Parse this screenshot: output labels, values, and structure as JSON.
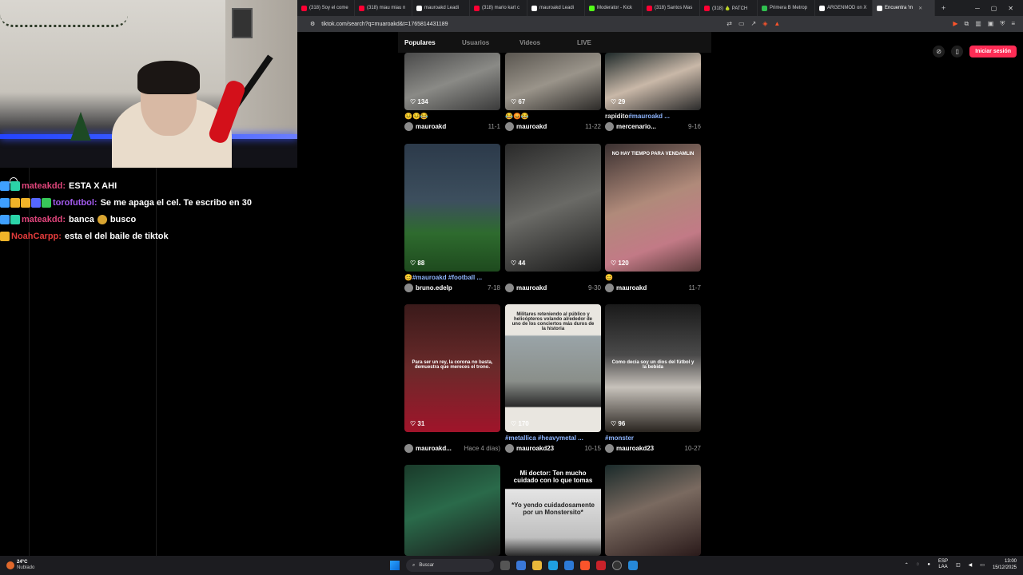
{
  "chat": {
    "messages": [
      {
        "user": "mateakdd:",
        "user_color": "#e0457b",
        "text": "ESTA X AHI",
        "badges": [
          "#3fa0ff",
          "#2bd4a8"
        ]
      },
      {
        "user": "torofutbol:",
        "user_color": "#a45bf0",
        "text": "Se me apaga el cel. Te escribo en 30",
        "badges": [
          "#3fa0ff",
          "#f0b429",
          "#f0b429",
          "#5667ff",
          "#38c95a"
        ]
      },
      {
        "user": "mateakdd:",
        "user_color": "#e0457b",
        "text_before": "banca",
        "text_after": "busco",
        "badges": [
          "#3fa0ff",
          "#2bd4a8"
        ]
      },
      {
        "user": "NoahCarpp:",
        "user_color": "#e23b3b",
        "text": "esta el del baile de tiktok",
        "badges": [
          "#f0b429"
        ]
      }
    ]
  },
  "browser": {
    "tabs": [
      {
        "label": "(318) Soy el come",
        "icon_color": "#ff0033"
      },
      {
        "label": "(318) miau miau n",
        "icon_color": "#ff0033"
      },
      {
        "label": "mauroakd Leadi",
        "icon_color": "#ffffff"
      },
      {
        "label": "(318) mario kart c",
        "icon_color": "#ff0033"
      },
      {
        "label": "mauroakd Leadi",
        "icon_color": "#ffffff"
      },
      {
        "label": "Moderator - Kick",
        "icon_color": "#53fc18"
      },
      {
        "label": "(318) Santos Mas",
        "icon_color": "#ff0033"
      },
      {
        "label": "(318) 🍐 PATCH",
        "icon_color": "#ff0033"
      },
      {
        "label": "Primera B Metrop",
        "icon_color": "#30c04f"
      },
      {
        "label": "ARGENMOD on X",
        "icon_color": "#ffffff"
      },
      {
        "label": "Encuentra 'm",
        "icon_color": "#ffffff",
        "active": true
      }
    ],
    "url": "tiktok.com/search?q=muaroakd&t=1765814431189"
  },
  "tiktok": {
    "search_tabs": [
      "Populares",
      "Usuarios",
      "Videos",
      "LIVE"
    ],
    "login_label": "Iniciar sesión",
    "videos": [
      {
        "likes": "134",
        "caption": "😣😣😂",
        "author": "mauroakd",
        "date": "11-1",
        "bg": "linear-gradient(160deg,#4a4a4a,#8a8a86 50%,#3a3a3a)"
      },
      {
        "likes": "67",
        "caption": "😂😡😂",
        "author": "mauroakd",
        "date": "11-22",
        "bg": "linear-gradient(160deg,#5a5650,#9a948a 50%,#2c2a28)"
      },
      {
        "likes": "29",
        "caption": "rapidito",
        "caption_tag": "#mauroakd ...",
        "author": "mercenario...",
        "date": "9-16",
        "bg": "linear-gradient(160deg,#1f2a2a,#c9b8a8 50%,#2a2a2a)"
      },
      {
        "likes": "88",
        "caption_tag": "#mauroakd #football ...",
        "caption_prefix": "😊",
        "author": "bruno.edelp",
        "date": "7-18",
        "bg": "linear-gradient(180deg,#2c3a4a 0%,#3d4f5e 45%,#2e6b2e 70%,#1e4a1e 100%)"
      },
      {
        "likes": "44",
        "caption": "",
        "author": "mauroakd",
        "date": "9-30",
        "bg": "linear-gradient(160deg,#2a2a2a,#6a6a66 50%,#1a1a1a)"
      },
      {
        "likes": "120",
        "caption": "😊",
        "author": "mauroakd",
        "date": "11-7",
        "bg": "linear-gradient(160deg,#3a3030,#b08a7a 45%,#c27a86 75%,#5a3a3a)",
        "overlay_text": "NO HAY TIEMPO PARA VENDAMLIN"
      },
      {
        "likes": "31",
        "caption": "",
        "author": "mauroakd...",
        "date": "Hace 4 días)",
        "bg": "linear-gradient(180deg,#3a1a1a,#6a2a2a 50%,#a0142a)",
        "overlay_text": "Para ser un rey, la corona no basta, demuestra que mereces el trono."
      },
      {
        "likes": "170",
        "caption_tag": "#metallica #heavymetal ...",
        "author": "mauroakd23",
        "date": "10-15",
        "bg": "linear-gradient(180deg,#e9e6e0 0%,#e9e6e0 24%,#9aa4a8 25%,#8a8f8a 60%,#2a2a2a 80%,#e9e6e0 81%)",
        "overlay_text": "Militares reteniendo al público y helicópteros volando alrededor de uno de los conciertos más duros de la historia",
        "overlay_dark": true
      },
      {
        "likes": "96",
        "caption_tag": "#monster",
        "author": "mauroakd23",
        "date": "10-27",
        "bg": "linear-gradient(180deg,#1a1a1a,#4a4a4a 40%,#c7c2bb 65%,#2a2520)",
        "overlay_text": "Como decía soy un dios del fútbol y la bebida"
      },
      {
        "likes": "",
        "caption": "",
        "author": "",
        "date": "",
        "bg": "linear-gradient(160deg,#1a3a2a,#2a6a4a 45%,#1a1a1a)"
      },
      {
        "likes": "",
        "caption": "",
        "author": "",
        "date": "",
        "bg": "linear-gradient(180deg,#000 0%,#000 26%,#e4e4e4 27%,#bfbfbf 80%,#2a2a2a 100%)",
        "overlay_text": "Mi doctor: Ten mucho cuidado con lo que tomas",
        "overlay_text2": "*Yo yendo cuidadosamente por un Monstersito*"
      },
      {
        "likes": "",
        "caption": "",
        "author": "",
        "date": "",
        "bg": "linear-gradient(160deg,#1a2a2a,#7a6a60 45%,#2a1a1a)"
      }
    ]
  },
  "taskbar": {
    "weather_temp": "24°C",
    "weather_desc": "Nublado",
    "search_placeholder": "Buscar",
    "lang": "ESP",
    "lang2": "LAA",
    "time": "13:00",
    "date": "15/12/2025"
  }
}
